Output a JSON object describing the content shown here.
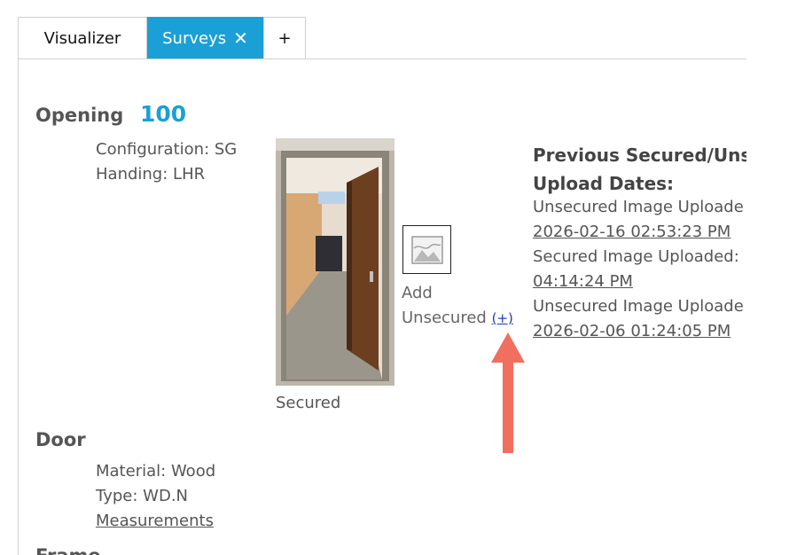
{
  "tabs": {
    "visualizer": "Visualizer",
    "surveys": "Surveys",
    "close": "✕",
    "add": "+"
  },
  "opening": {
    "heading": "Opening",
    "number": "100",
    "configuration_label": "Configuration:",
    "configuration_value": "SG",
    "handing_label": "Handing:",
    "handing_value": "LHR"
  },
  "photo": {
    "caption": "Secured"
  },
  "add_unsecured": {
    "line1": "Add",
    "line2": "Unsecured",
    "plus": "(+)"
  },
  "previous": {
    "title_line1": "Previous Secured/Uns",
    "title_line2": "Upload Dates:",
    "items": [
      {
        "label": "Unsecured Image Uploade",
        "date": "2026-02-16 02:53:23 PM"
      },
      {
        "label": "Secured Image Uploaded:",
        "date": "04:14:24 PM"
      },
      {
        "label": "Unsecured Image Uploade",
        "date": "2026-02-06 01:24:05 PM"
      }
    ]
  },
  "door": {
    "heading": "Door",
    "material_label": "Material:",
    "material_value": "Wood",
    "type_label": "Type:",
    "type_value": "WD.N",
    "measurements_link": "Measurements"
  },
  "frame": {
    "heading": "Frame"
  },
  "colors": {
    "accent": "#1aa0d6",
    "arrow": "#f26e5e",
    "link": "#1a3fb0"
  }
}
